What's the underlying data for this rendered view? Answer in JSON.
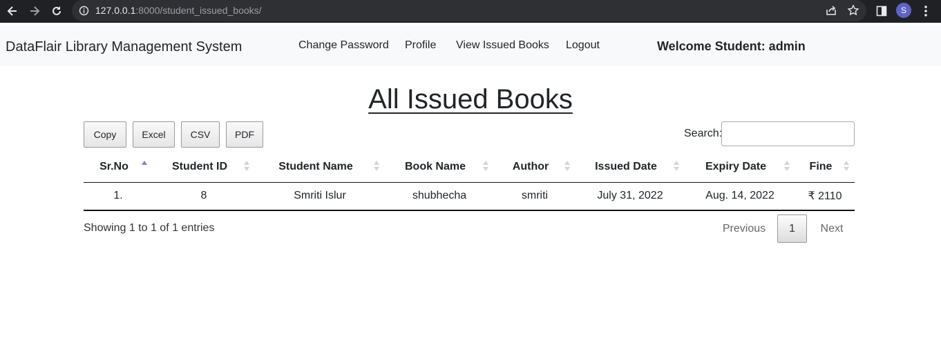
{
  "browser": {
    "url_host": "127.0.0.1",
    "url_rest": ":8000/student_issued_books/",
    "profile_initial": "S"
  },
  "navbar": {
    "brand": "DataFlair Library Management System",
    "links": [
      "Change Password",
      "Profile",
      "View Issued Books",
      "Logout"
    ],
    "welcome": "Welcome Student: admin"
  },
  "page": {
    "title": "All Issued Books"
  },
  "toolbar": {
    "buttons": [
      "Copy",
      "Excel",
      "CSV",
      "PDF"
    ],
    "search_label": "Search:",
    "search_value": ""
  },
  "table": {
    "headers": [
      "Sr.No",
      "Student ID",
      "Student Name",
      "Book Name",
      "Author",
      "Issued Date",
      "Expiry Date",
      "Fine"
    ],
    "sorted_column": "Sr.No",
    "sort_direction": "ascending",
    "rows": [
      [
        "1.",
        "8",
        "Smriti Islur",
        "shubhecha",
        "smriti",
        "July 31, 2022",
        "Aug. 14, 2022",
        "₹ 2110"
      ]
    ]
  },
  "footer": {
    "info": "Showing 1 to 1 of 1 entries",
    "previous": "Previous",
    "current_page": "1",
    "next": "Next"
  },
  "colors": {
    "chrome_bg": "#202124",
    "navbar_bg": "#f8f9fa",
    "sort_active": "#7b84c8",
    "avatar": "#5e63c7"
  }
}
